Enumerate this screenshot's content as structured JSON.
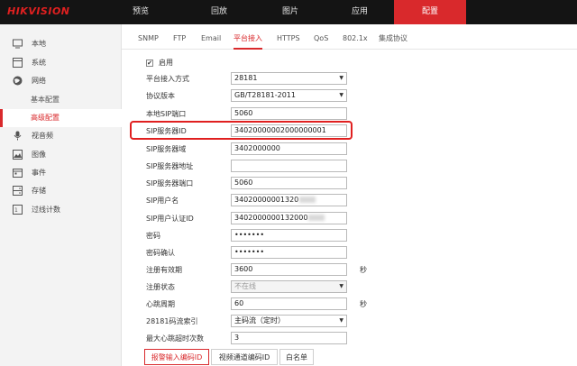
{
  "brand": {
    "logo": "HIKVISION",
    "accent": "#d9292c"
  },
  "nav": [
    {
      "label": "预览"
    },
    {
      "label": "回放"
    },
    {
      "label": "图片"
    },
    {
      "label": "应用"
    },
    {
      "label": "配置"
    }
  ],
  "sidebar": {
    "items": [
      {
        "label": "本地",
        "icon": "monitor-icon"
      },
      {
        "label": "系统",
        "icon": "system-icon"
      },
      {
        "label": "网络",
        "icon": "globe-icon"
      }
    ],
    "network_sub": [
      {
        "label": "基本配置"
      },
      {
        "label": "高级配置"
      }
    ],
    "items2": [
      {
        "label": "视音频",
        "icon": "mic-icon"
      },
      {
        "label": "图像",
        "icon": "image-icon"
      },
      {
        "label": "事件",
        "icon": "calendar-icon"
      },
      {
        "label": "存储",
        "icon": "storage-icon"
      },
      {
        "label": "过线计数",
        "icon": "count-icon"
      }
    ]
  },
  "tabs": [
    {
      "label": "SNMP"
    },
    {
      "label": "FTP"
    },
    {
      "label": "Email"
    },
    {
      "label": "平台接入"
    },
    {
      "label": "HTTPS"
    },
    {
      "label": "QoS"
    },
    {
      "label": "802.1x"
    },
    {
      "label": "集成协议"
    }
  ],
  "form": {
    "enable_label": "启用",
    "enable_checked": true,
    "rows": [
      {
        "label": "平台接入方式",
        "value": "28181",
        "type": "select"
      },
      {
        "label": "协议版本",
        "value": "GB/T28181-2011",
        "type": "select"
      },
      {
        "label": "本地SIP端口",
        "value": "5060",
        "type": "text"
      },
      {
        "label": "SIP服务器ID",
        "value": "34020000002000000001",
        "type": "text"
      },
      {
        "label": "SIP服务器域",
        "value": "3402000000",
        "type": "text"
      },
      {
        "label": "SIP服务器地址",
        "value": "",
        "type": "text"
      },
      {
        "label": "SIP服务器端口",
        "value": "5060",
        "type": "text"
      },
      {
        "label": "SIP用户名",
        "value": "34020000001320",
        "type": "text"
      },
      {
        "label": "SIP用户认证ID",
        "value": "3402000000132000",
        "type": "text"
      },
      {
        "label": "密码",
        "value": "•••••••",
        "type": "password"
      },
      {
        "label": "密码确认",
        "value": "•••••••",
        "type": "password"
      },
      {
        "label": "注册有效期",
        "value": "3600",
        "type": "text",
        "unit": "秒"
      },
      {
        "label": "注册状态",
        "value": "不在线",
        "type": "select-disabled"
      },
      {
        "label": "心跳周期",
        "value": "60",
        "type": "text",
        "unit": "秒"
      },
      {
        "label": "28181码流索引",
        "value": "主码流（定时）",
        "type": "select"
      },
      {
        "label": "最大心跳超时次数",
        "value": "3",
        "type": "text"
      }
    ]
  },
  "subtabs": [
    {
      "label": "报警输入编码ID"
    },
    {
      "label": "视频通道编码ID"
    },
    {
      "label": "白名单"
    }
  ]
}
